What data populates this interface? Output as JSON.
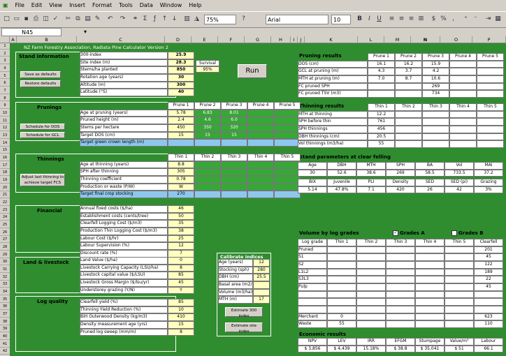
{
  "menu": [
    "File",
    "Edit",
    "View",
    "Insert",
    "Format",
    "Tools",
    "Data",
    "Window",
    "Help"
  ],
  "toolbar": {
    "zoom": "75%",
    "font": "Arial",
    "size": "10"
  },
  "namebox": "N45",
  "columns": [
    "A",
    "B",
    "C",
    "D",
    "E",
    "F",
    "G",
    "H",
    "I",
    "J",
    "K",
    "L",
    "M",
    "N",
    "O",
    "P"
  ],
  "rows": [
    "1",
    "2",
    "3",
    "4",
    "5",
    "6",
    "7",
    "8",
    "9",
    "10",
    "11",
    "12",
    "13",
    "14",
    "15",
    "16",
    "17",
    "18",
    "19",
    "20",
    "21",
    "22",
    "23",
    "24",
    "25",
    "26",
    "27",
    "28",
    "29",
    "30",
    "31",
    "32",
    "33",
    "34",
    "35",
    "36",
    "37",
    "38",
    "39",
    "40",
    "41",
    "42"
  ],
  "title": "NZ Farm Forestry Association, Radiata Pine Calculator Version 2",
  "stand": {
    "heading": "Stand information",
    "labels": [
      "300-index",
      "Site index (m)",
      "Stems/ha planted",
      "Rotation age (years)",
      "Altitude (m)",
      "Latitude (°S)"
    ],
    "values": [
      "25.9",
      "28.3",
      "850",
      "30",
      "300",
      "40"
    ],
    "survival_label": "Survival",
    "survival_value": "95%",
    "btn_save": "Save as defaults",
    "btn_restore": "Restore defaults",
    "run": "Run"
  },
  "prunings": {
    "heading": "Prunings",
    "cols": [
      "Prune 1",
      "Prune 2",
      "Prune 3",
      "Prune 4",
      "Prune 5"
    ],
    "labels": [
      "Age at pruning (years)",
      "Pruned height (m)",
      "Stems per hectare",
      "Target DOS (cm)",
      "Target green crown length (m)"
    ],
    "values": [
      [
        "5.78",
        "6.83",
        "8.01",
        "",
        ""
      ],
      [
        "2.4",
        "4.6",
        "6.0",
        "",
        ""
      ],
      [
        "450",
        "350",
        "320",
        "",
        ""
      ],
      [
        "15",
        "15",
        "15",
        "",
        ""
      ],
      [
        "",
        "",
        "",
        "",
        ""
      ]
    ],
    "btn_dos": "Schedule for DOS",
    "btn_gcl": "Schedule for GCL"
  },
  "thinnings": {
    "heading": "Thinnings",
    "cols": [
      "Thin 1",
      "Thin 2",
      "Thin 3",
      "Thin 4",
      "Thin 5"
    ],
    "labels": [
      "Age at thinning (years)",
      "SPH after thinning",
      "Thinning coefficient",
      "Production or waste (P/W)",
      "Target final crop stocking"
    ],
    "values": [
      [
        "8.8",
        "",
        "",
        "",
        ""
      ],
      [
        "305",
        "",
        "",
        "",
        ""
      ],
      [
        "0.78",
        "",
        "",
        "",
        ""
      ],
      [
        "W",
        "",
        "",
        "",
        ""
      ],
      [
        "270",
        "",
        "",
        "",
        ""
      ]
    ],
    "btn_adjust": "Adjust last thinning to achieve target FCS"
  },
  "financial": {
    "heading": "Financial",
    "labels": [
      "Annual fixed costs ($/ha)",
      "Establishment costs (cents/tree)",
      "Clearfell Logging Cost ($/m3)",
      "Production Thin Logging Cost ($/m3)",
      "Labour Cost ($/hr)",
      "Labour Supervision (%)",
      "Discount rate (%)"
    ],
    "values": [
      "46",
      "50",
      "35",
      "38",
      "25",
      "12",
      "7"
    ]
  },
  "land": {
    "heading": "Land & livestock",
    "labels": [
      "Land Value ($/ha)",
      "Livestock Carrying Capacity (LSU/ha)",
      "Livestock capital value ($/LSU)",
      "Livestock Gross Margin ($/lsu/yr)",
      "Understorey grazing (Y/N)"
    ],
    "values": [
      "0",
      "8",
      "85",
      "45",
      "Y"
    ]
  },
  "logq": {
    "heading": "Log quality",
    "labels": [
      "Clearfell yield (%)",
      "Thinning Yield Reduction (%)",
      "BiH Outerwood Density (kg/m3)",
      "Density measurement age (yrs)",
      "Pruned log sweep (mm/m)"
    ],
    "values": [
      "85",
      "10",
      "410",
      "15",
      "8"
    ]
  },
  "calibrate": {
    "heading": "Calibrate indices",
    "labels": [
      "Age (years)",
      "Stocking (sph)",
      "DBH (cm)",
      "Basal area (m2/ha)",
      "Volume (m3/ha)",
      "MTH (m)"
    ],
    "values": [
      "12",
      "280",
      "25.5",
      "",
      "",
      "17"
    ],
    "btn_300": "Estimate 300 index",
    "btn_site": "Estimate site index"
  },
  "pruning_results": {
    "heading": "Pruning results",
    "cols": [
      "Prune 1",
      "Prune 2",
      "Prune 3",
      "Prune 4",
      "Prune 5"
    ],
    "labels": [
      "DOS (cm)",
      "GCL at pruning (m)",
      "MTH at pruning (m)",
      "FC pruned SPH",
      "FC pruned TSV (m3)"
    ],
    "values": [
      [
        "16.1",
        "16.2",
        "15.9",
        "",
        ""
      ],
      [
        "4.3",
        "3.7",
        "4.2",
        "",
        ""
      ],
      [
        "7.0",
        "8.7",
        "10.6",
        "",
        ""
      ],
      [
        "",
        "",
        "269",
        "",
        ""
      ],
      [
        "",
        "",
        "734",
        "",
        ""
      ]
    ]
  },
  "thinning_results": {
    "heading": "Thinning results",
    "cols": [
      "Thin 1",
      "Thin 2",
      "Thin 3",
      "Thin 4",
      "Thin 5"
    ],
    "labels": [
      "MTH at thinning",
      "SPH before thin",
      "SPH thinnings",
      "DBH thinnings (cm)",
      "Vol thinnings (m3/ha)"
    ],
    "values": [
      [
        "12.2",
        "",
        "",
        "",
        ""
      ],
      [
        "761",
        "",
        "",
        "",
        ""
      ],
      [
        "456",
        "",
        "",
        "",
        ""
      ],
      [
        "20.5",
        "",
        "",
        "",
        ""
      ],
      [
        "55",
        "",
        "",
        "",
        ""
      ]
    ]
  },
  "clearfell": {
    "heading": "Stand parameters at clear felling",
    "cols1": [
      "Age",
      "DBH",
      "MTH",
      "SPH",
      "BA",
      "Vol",
      "MAI"
    ],
    "vals1": [
      "30",
      "52.6",
      "38.6",
      "269",
      "58.5",
      "733.5",
      "37.2"
    ],
    "cols2": [
      "BIX",
      "Juvenile",
      "PLI",
      "Density",
      "SED",
      "SED (pi)",
      "Grazing"
    ],
    "vals2": [
      "5.14",
      "47.8%",
      "7.1",
      "420",
      "26",
      "42",
      "3%"
    ]
  },
  "volume": {
    "heading": "Volume by log grades",
    "grades_a": "Grades A",
    "grades_b": "Grades B",
    "cols": [
      "Log grade",
      "Thin 1",
      "Thin 2",
      "Thin 3",
      "Thin 4",
      "Thin 5",
      "Clearfell"
    ],
    "rows": [
      [
        "Pruned",
        "",
        "",
        "",
        "",
        "",
        "201"
      ],
      [
        "S1",
        "",
        "",
        "",
        "",
        "",
        "45"
      ],
      [
        "S2",
        "",
        "",
        "",
        "",
        "",
        "122"
      ],
      [
        "L1L2",
        "",
        "",
        "",
        "",
        "",
        "189"
      ],
      [
        "S3L3",
        "",
        "",
        "",
        "",
        "",
        "22"
      ],
      [
        "Pulp",
        "",
        "",
        "",
        "",
        "",
        "45"
      ],
      [
        "",
        "",
        "",
        "",
        "",
        "",
        ""
      ],
      [
        "",
        "",
        "",
        "",
        "",
        "",
        ""
      ],
      [
        "",
        "",
        "",
        "",
        "",
        "",
        ""
      ],
      [
        "Merchant",
        "0",
        "",
        "",
        "",
        "",
        "623"
      ],
      [
        "Waste",
        "55",
        "",
        "",
        "",
        "",
        "110"
      ]
    ]
  },
  "economic": {
    "heading": "Economic results",
    "cols": [
      "NPV",
      "LEV",
      "IRR",
      "EFGM",
      "Stumpage",
      "Value/m³",
      "Labour"
    ],
    "vals": [
      "$ 3,856",
      "$ 4,439",
      "15.18%",
      "$ 38.8",
      "$ 35,041",
      "$ 51",
      "66.1"
    ]
  }
}
